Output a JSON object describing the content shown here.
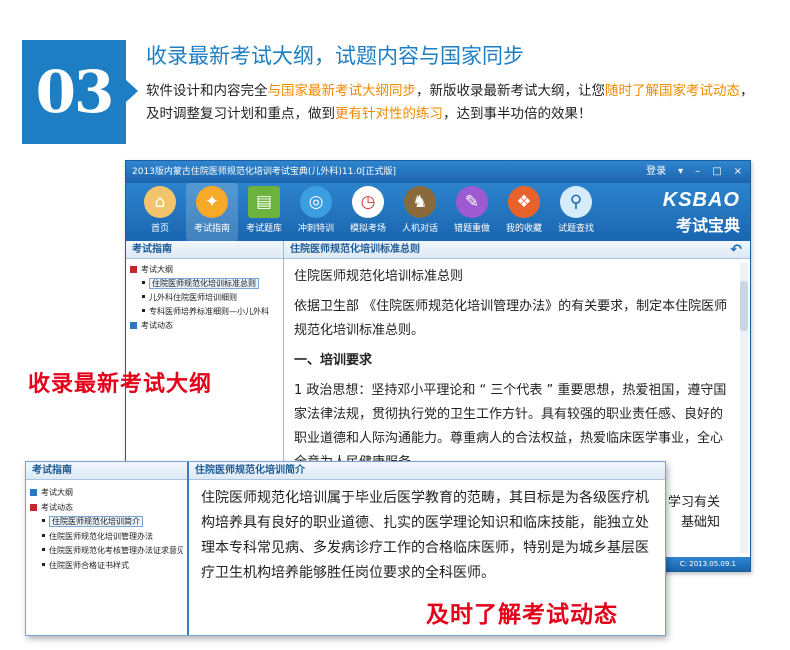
{
  "promo": {
    "number": "03",
    "title": "收录最新考试大纲，试题内容与国家同步",
    "desc_1": "软件设计和内容完全",
    "desc_hl_1": "与国家最新考试大纲同步",
    "desc_2": "，新版收录最新考试大纲，让您",
    "desc_hl_2": "随时了解国家考试动态",
    "desc_3": "，及时调整复习计划和重点，做到",
    "desc_hl_3": "更有针对性的练习",
    "desc_4": "，达到事半功倍的效果！",
    "highlight_color": "#f08a00",
    "accent_color": "#1e7ec3"
  },
  "window": {
    "title": "2013版内蒙古住院医师规范化培训考试宝典(儿外科)11.0[正式版]",
    "login": "登录",
    "toolbar": [
      {
        "label": "首页",
        "icon": "home-icon"
      },
      {
        "label": "考试指南",
        "icon": "compass-icon"
      },
      {
        "label": "考试题库",
        "icon": "books-icon"
      },
      {
        "label": "冲刺特训",
        "icon": "globe-icon"
      },
      {
        "label": "模拟考场",
        "icon": "clock-icon"
      },
      {
        "label": "人机对话",
        "icon": "chess-icon"
      },
      {
        "label": "错题重做",
        "icon": "pencil-icon"
      },
      {
        "label": "我的收藏",
        "icon": "treasure-icon"
      },
      {
        "label": "试题查找",
        "icon": "magnifier-icon"
      }
    ],
    "brand_top": "KSBAO",
    "brand_bottom": "考试宝典",
    "sidebar_title": "考试指南",
    "tree": {
      "root1": "考试大纲",
      "child1": "住院医师规范化培训标准总则",
      "child2": "儿外科住院医师培训细则",
      "child3": "专科医师培养标准细则—小儿外科",
      "root2": "考试动态"
    },
    "content_title": "住院医师规范化培训标准总则",
    "content": {
      "heading": "住院医师规范化培训标准总则",
      "para1": "依据卫生部 《住院医师规范化培训管理办法》的有关要求，制定本住院医师规范化培训标准总则。",
      "section1": "一、培训要求",
      "para2": "1 政治思想：坚持邓小平理论和 “ 三个代表 ” 重要思想，热爱祖国，遵守国家法律法规，贯彻执行党的卫生工作方针。具有较强的职业责任感、良好的职业道德和人际沟通能力。尊重病人的合法权益，热爱临床医学事业，全心全意为人民健康服务。",
      "peek_right_1": "学习有关",
      "peek_right_2": "基础知"
    },
    "status": "C: 2013.05.09.1"
  },
  "captions": {
    "top": "收录最新考试大纲",
    "bottom": "及时了解考试动态",
    "color": "#e5001a"
  },
  "overlay": {
    "sidebar_title": "考试指南",
    "tree": {
      "root1": "考试大纲",
      "root2": "考试动态",
      "child1": "住院医师规范化培训简介",
      "child2": "住院医师规范化培训管理办法",
      "child3": "住院医师规范化考核管理办法证求意见",
      "child4": "住院医师合格证书样式"
    },
    "content_title": "住院医师规范化培训简介",
    "text": "住院医师规范化培训属于毕业后医学教育的范畴，其目标是为各级医疗机构培养具有良好的职业道德、扎实的医学理论知识和临床技能，能独立处理本专科常见病、多发病诊疗工作的合格临床医师，特别是为城乡基层医疗卫生机构培养能够胜任岗位要求的全科医师。"
  }
}
